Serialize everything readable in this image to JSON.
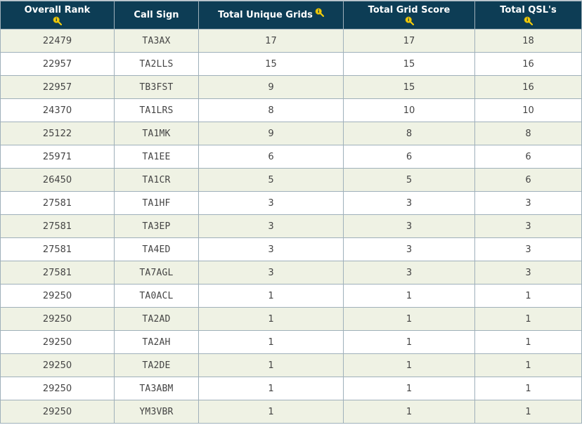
{
  "headers": {
    "rank": "Overall Rank",
    "call": "Call Sign",
    "grids": "Total Unique Grids",
    "score": "Total Grid Score",
    "qsl": "Total QSL's"
  },
  "sort_icon": "magnifier-info-icon",
  "colors": {
    "header_bg": "#0d3d55",
    "row_odd": "#eff2e4",
    "row_even": "#ffffff",
    "icon": "#f2cc0c"
  },
  "rows": [
    {
      "rank": "22479",
      "call": "TA3AX",
      "grids": "17",
      "score": "17",
      "qsl": "18"
    },
    {
      "rank": "22957",
      "call": "TA2LLS",
      "grids": "15",
      "score": "15",
      "qsl": "16"
    },
    {
      "rank": "22957",
      "call": "TB3FST",
      "grids": "9",
      "score": "15",
      "qsl": "16"
    },
    {
      "rank": "24370",
      "call": "TA1LRS",
      "grids": "8",
      "score": "10",
      "qsl": "10"
    },
    {
      "rank": "25122",
      "call": "TA1MK",
      "grids": "9",
      "score": "8",
      "qsl": "8"
    },
    {
      "rank": "25971",
      "call": "TA1EE",
      "grids": "6",
      "score": "6",
      "qsl": "6"
    },
    {
      "rank": "26450",
      "call": "TA1CR",
      "grids": "5",
      "score": "5",
      "qsl": "6"
    },
    {
      "rank": "27581",
      "call": "TA1HF",
      "grids": "3",
      "score": "3",
      "qsl": "3"
    },
    {
      "rank": "27581",
      "call": "TA3EP",
      "grids": "3",
      "score": "3",
      "qsl": "3"
    },
    {
      "rank": "27581",
      "call": "TA4ED",
      "grids": "3",
      "score": "3",
      "qsl": "3"
    },
    {
      "rank": "27581",
      "call": "TA7AGL",
      "grids": "3",
      "score": "3",
      "qsl": "3"
    },
    {
      "rank": "29250",
      "call": "TA0ACL",
      "grids": "1",
      "score": "1",
      "qsl": "1"
    },
    {
      "rank": "29250",
      "call": "TA2AD",
      "grids": "1",
      "score": "1",
      "qsl": "1"
    },
    {
      "rank": "29250",
      "call": "TA2AH",
      "grids": "1",
      "score": "1",
      "qsl": "1"
    },
    {
      "rank": "29250",
      "call": "TA2DE",
      "grids": "1",
      "score": "1",
      "qsl": "1"
    },
    {
      "rank": "29250",
      "call": "TA3ABM",
      "grids": "1",
      "score": "1",
      "qsl": "1"
    },
    {
      "rank": "29250",
      "call": "YM3VBR",
      "grids": "1",
      "score": "1",
      "qsl": "1"
    }
  ]
}
